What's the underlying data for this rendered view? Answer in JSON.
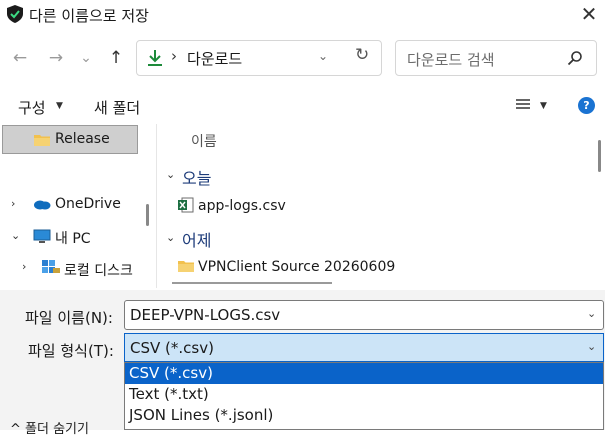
{
  "window": {
    "title": "다른 이름으로 저장",
    "close_glyph": "✕"
  },
  "nav": {
    "back_glyph": "←",
    "forward_glyph": "→",
    "recent_glyph": "⌄",
    "up_glyph": "↑"
  },
  "address": {
    "chevron": "›",
    "path": "다운로드",
    "dropdown_glyph": "⌄",
    "refresh_glyph": "↻"
  },
  "search": {
    "placeholder": "다운로드 검색"
  },
  "toolbar": {
    "organize_label": "구성",
    "caret": "▼",
    "new_folder_label": "새 폴더",
    "help_glyph": "?"
  },
  "sidebar": {
    "selected_item": "Release",
    "items": [
      {
        "label": "OneDrive",
        "expander": "›"
      },
      {
        "label": "내 PC",
        "expander": "⌄"
      },
      {
        "label": "로컬 디스크",
        "expander": "›"
      }
    ]
  },
  "content": {
    "column_name": "이름",
    "groups": [
      {
        "label": "오늘",
        "expander": "⌄",
        "files": [
          {
            "name": "app-logs.csv",
            "icon": "excel-csv-icon"
          }
        ]
      },
      {
        "label": "어제",
        "expander": "⌄",
        "files": [
          {
            "name": "VPNClient Source 20260609",
            "icon": "folder-icon"
          }
        ]
      }
    ]
  },
  "save_form": {
    "filename_label": "파일 이름(N):",
    "filename_value": "DEEP-VPN-LOGS.csv",
    "filetype_label": "파일 형식(T):",
    "filetype_value": "CSV (*.csv)",
    "dropdown_caret": "⌄",
    "filetype_options": [
      "CSV (*.csv)",
      "Text (*.txt)",
      "JSON Lines (*.jsonl)"
    ],
    "hide_folders_label": "폴더 숨기기",
    "hide_folders_expander": "^"
  },
  "colors": {
    "accent": "#0a63c9",
    "selection_bg": "#cce4f7",
    "group_text": "#1e3c7a",
    "folder": "#f2c14e",
    "excel": "#1d6f42"
  }
}
